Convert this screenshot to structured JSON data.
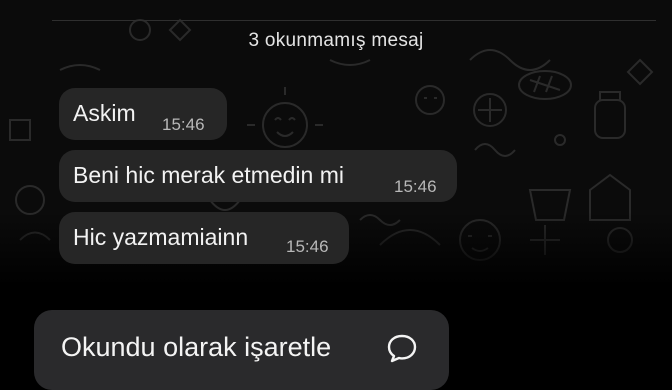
{
  "banner": {
    "unread_text": "3 okunmamış mesaj"
  },
  "messages": [
    {
      "text": "Askim",
      "time": "15:46"
    },
    {
      "text": "Beni hic merak etmedin mi",
      "time": "15:46"
    },
    {
      "text": "Hic yazmamiainn",
      "time": "15:46"
    }
  ],
  "context_menu": {
    "items": [
      {
        "label": "Okundu olarak işaretle",
        "icon": "message-bubble-icon"
      }
    ]
  },
  "colors": {
    "background": "#000000",
    "chat_wallpaper": "#0b0b0b",
    "bubble": "#262626",
    "menu": "#2a2a2c",
    "text": "#f2f2f2",
    "timestamp": "#b8b8b8"
  }
}
